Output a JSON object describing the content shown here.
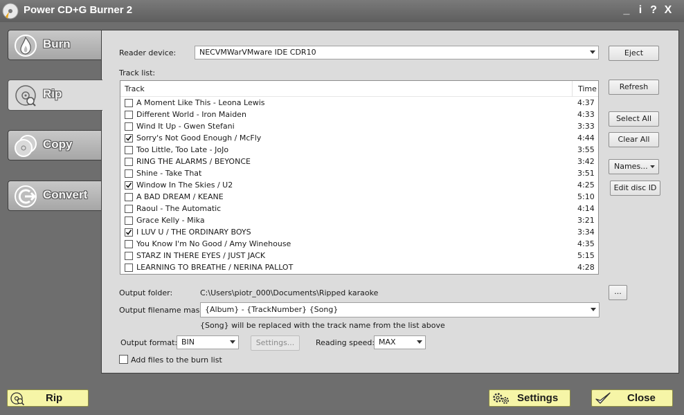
{
  "app": {
    "title": "Power CD+G Burner 2",
    "window_controls": {
      "minimize": "_",
      "info": "i",
      "help": "?",
      "close": "X"
    }
  },
  "nav": {
    "items": [
      {
        "label": "Burn",
        "icon": "flame-icon",
        "active": false
      },
      {
        "label": "Rip",
        "icon": "rip-disc-icon",
        "active": true
      },
      {
        "label": "Copy",
        "icon": "copy-discs-icon",
        "active": false
      },
      {
        "label": "Convert",
        "icon": "convert-arrow-icon",
        "active": false
      }
    ]
  },
  "rip": {
    "reader_label": "Reader device:",
    "reader_value": "NECVMWarVMware IDE CDR10",
    "tracklist_label": "Track list:",
    "columns": {
      "track": "Track",
      "time": "Time"
    },
    "tracks": [
      {
        "name": "A Moment Like This - Leona Lewis",
        "time": "4:37",
        "checked": false
      },
      {
        "name": "Different World - Iron Maiden",
        "time": "4:33",
        "checked": false
      },
      {
        "name": "Wind It Up - Gwen Stefani",
        "time": "3:33",
        "checked": false
      },
      {
        "name": "Sorry's Not Good Enough / McFly",
        "time": "4:44",
        "checked": true
      },
      {
        "name": "Too Little, Too Late - JoJo",
        "time": "3:55",
        "checked": false
      },
      {
        "name": "RING THE ALARMS / BEYONCE",
        "time": "3:42",
        "checked": false
      },
      {
        "name": "Shine - Take That",
        "time": "3:51",
        "checked": false
      },
      {
        "name": "Window In The Skies / U2",
        "time": "4:25",
        "checked": true
      },
      {
        "name": "A BAD DREAM / KEANE",
        "time": "5:10",
        "checked": false
      },
      {
        "name": "Raoul - The Automatic",
        "time": "4:14",
        "checked": false
      },
      {
        "name": "Grace Kelly - Mika",
        "time": "3:21",
        "checked": false
      },
      {
        "name": "I LUV U / THE ORDINARY BOYS",
        "time": "3:34",
        "checked": true
      },
      {
        "name": "You Know I'm No Good / Amy Winehouse",
        "time": "4:35",
        "checked": false
      },
      {
        "name": "STARZ IN THERE EYES / JUST JACK",
        "time": "5:15",
        "checked": false
      },
      {
        "name": "LEARNING TO BREATHE / NERINA PALLOT",
        "time": "4:28",
        "checked": false
      }
    ],
    "buttons": {
      "eject": "Eject",
      "refresh": "Refresh",
      "select_all": "Select All",
      "clear_all": "Clear All",
      "names": "Names...",
      "edit_disc_id": "Edit disc ID",
      "browse": "..."
    },
    "output_folder_label": "Output folder:",
    "output_folder_value": "C:\\Users\\piotr_000\\Documents\\Ripped karaoke",
    "mask_label": "Output filename mask:",
    "mask_value": "{Album} - {TrackNumber} {Song}",
    "mask_hint": "{Song} will be replaced with the track name from the list above",
    "format_label": "Output format:",
    "format_value": "BIN",
    "settings_small": "Settings...",
    "speed_label": "Reading speed:",
    "speed_value": "MAX",
    "add_to_burn_label": "Add files to the burn list",
    "add_to_burn_checked": false
  },
  "bottom": {
    "rip": "Rip",
    "settings": "Settings",
    "close": "Close"
  },
  "colors": {
    "chrome": "#6e6e6e",
    "panel": "#dcdcdc",
    "bottom_button": "#f6f5a7"
  }
}
